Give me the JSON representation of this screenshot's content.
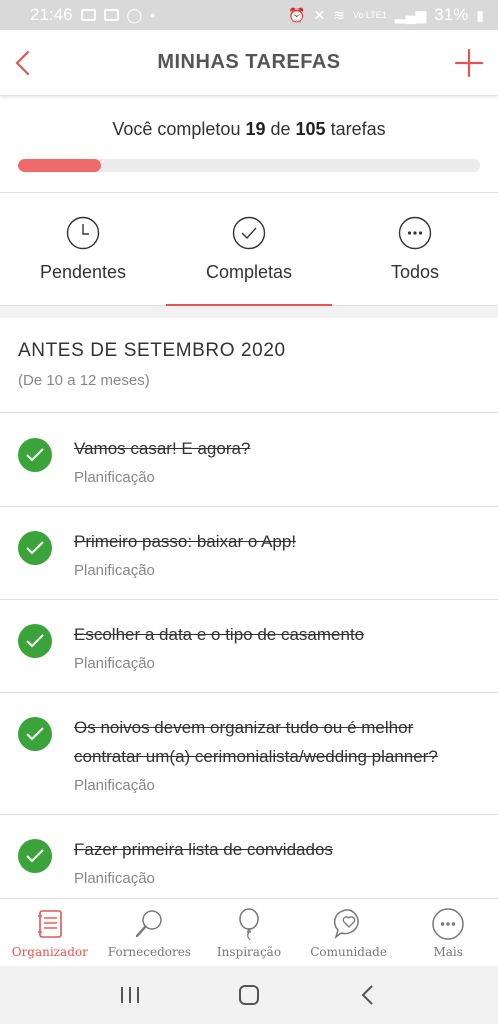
{
  "status_bar": {
    "time": "21:46",
    "battery": "31%",
    "network": "Vo LTE1"
  },
  "header": {
    "title": "MINHAS TAREFAS",
    "back_icon": "chevron-left-icon",
    "add_icon": "plus-icon"
  },
  "progress": {
    "prefix": "Você completou ",
    "completed": "19",
    "middle": " de ",
    "total": "105",
    "suffix": " tarefas",
    "fraction": 0.18
  },
  "tabs": [
    {
      "label": "Pendentes",
      "icon": "clock-icon",
      "active": false
    },
    {
      "label": "Completas",
      "icon": "check-circle-icon",
      "active": true
    },
    {
      "label": "Todos",
      "icon": "more-circle-icon",
      "active": false
    }
  ],
  "section": {
    "title": "ANTES DE SETEMBRO 2020",
    "subtitle": "(De 10 a 12 meses)"
  },
  "tasks": [
    {
      "title": "Vamos casar! E agora?",
      "category": "Planificação"
    },
    {
      "title": "Primeiro passo: baixar o App!",
      "category": "Planificação"
    },
    {
      "title": "Escolher a data e o tipo de casamento",
      "category": "Planificação"
    },
    {
      "title": "Os noivos devem organizar tudo ou é melhor contratar um(a) cerimonialista/wedding planner?",
      "category": "Planificação"
    },
    {
      "title": "Fazer primeira lista de convidados",
      "category": "Planificação"
    }
  ],
  "bottom_nav": [
    {
      "label": "Organizador",
      "icon": "notebook-icon",
      "active": true
    },
    {
      "label": "Fornecedores",
      "icon": "magnifier-icon",
      "active": false
    },
    {
      "label": "Inspiração",
      "icon": "balloon-icon",
      "active": false
    },
    {
      "label": "Comunidade",
      "icon": "chat-heart-icon",
      "active": false
    },
    {
      "label": "Mais",
      "icon": "more-circle-icon",
      "active": false
    }
  ],
  "colors": {
    "accent": "#e05656",
    "progress": "#ef6a6a",
    "check": "#3aa33a"
  }
}
